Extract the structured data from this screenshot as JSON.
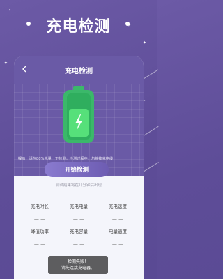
{
  "hero": {
    "title": "充电检测"
  },
  "screen": {
    "title": "充电检测",
    "tip_label": "提示：",
    "tip_text": "请在80%电量一下检测，检测过程中，勿摇摔充电线",
    "start_label": "开始检测",
    "result_note": "测试结果将在几分钟后出现"
  },
  "stats": [
    {
      "label": "充电时长",
      "value": "— —"
    },
    {
      "label": "充电电量",
      "value": "— —"
    },
    {
      "label": "充电速度",
      "value": "— —"
    },
    {
      "label": "峰值功率",
      "value": "— —"
    },
    {
      "label": "充电容量",
      "value": "— —"
    },
    {
      "label": "电量速度",
      "value": "— —"
    }
  ],
  "toast": {
    "line1": "检测失败！",
    "line2": "请先连接充电器。"
  },
  "colors": {
    "background": "#5e4d98",
    "accent": "#6a5aa6",
    "battery_green": "#4cd964",
    "battery_shell": "#3bb86a"
  },
  "icons": [
    "back-icon",
    "battery-icon",
    "lightning-icon",
    "sparkle-icon"
  ]
}
